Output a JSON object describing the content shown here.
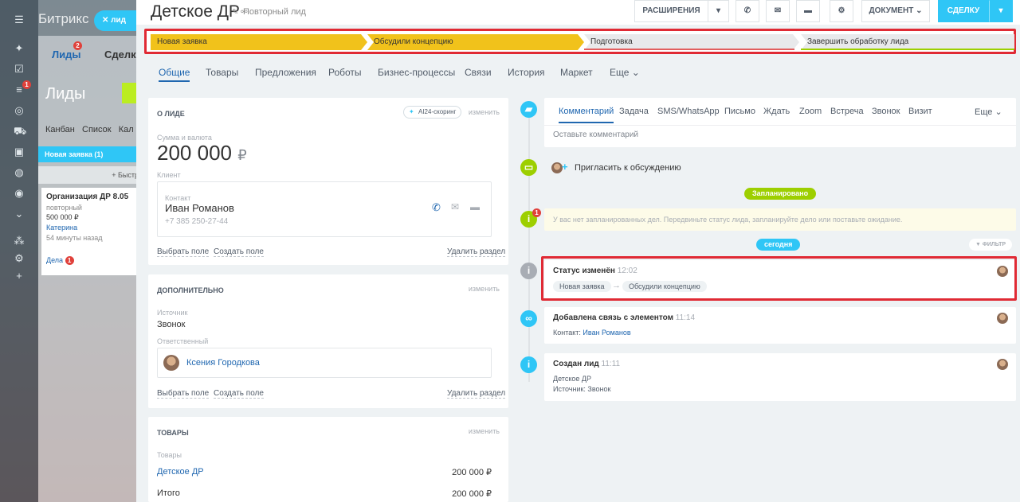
{
  "bg": {
    "portal_title": "Битрикс",
    "lid_button": "лид",
    "tab_leads": "Лиды",
    "tab_leads_badge": "2",
    "tab_deals": "Сделки",
    "nav_badge": "1",
    "page_title": "Лиды",
    "views": "Канбан   Список   Кал",
    "column": "Новая заявка (1)",
    "add_button": "+ Быстр",
    "card_title": "Организация ДР 8.05",
    "card_sub": "повторный",
    "card_price": "500 000 ₽",
    "card_person": "Катерина",
    "card_time": "54 минуты назад",
    "card_deals": "Дела",
    "card_deals_badge": "1"
  },
  "header": {
    "title": "Детское ДР",
    "subtitle": "Повторный лид",
    "btn_extensions": "РАСШИРЕНИЯ",
    "btn_document": "ДОКУМЕНТ",
    "btn_deal": "СДЕЛКУ"
  },
  "stages": [
    {
      "label": "Новая заявка",
      "color": "#f1c21b"
    },
    {
      "label": "Обсудили концепцию",
      "color": "#f1c21b"
    },
    {
      "label": "Подготовка",
      "color": "#e8e9eb"
    },
    {
      "label": "Завершить обработку лида",
      "color": "#e8e9eb"
    }
  ],
  "tabs": [
    "Общие",
    "Товары",
    "Предложения",
    "Роботы",
    "Бизнес-процессы",
    "Связи",
    "История",
    "Маркет",
    "Еще"
  ],
  "about": {
    "title": "О ЛИДЕ",
    "ai_scoring": "AI24-скоринг",
    "edit": "изменить",
    "sum_label": "Сумма и валюта",
    "sum_value": "200 000",
    "currency": "₽",
    "client_label": "Клиент",
    "contact_label": "Контакт",
    "contact_name": "Иван Романов",
    "contact_phone": "+7 385 250-27-44",
    "select_field": "Выбрать поле",
    "create_field": "Создать поле",
    "delete_section": "Удалить раздел"
  },
  "extra": {
    "title": "ДОПОЛНИТЕЛЬНО",
    "edit": "изменить",
    "source_label": "Источник",
    "source_value": "Звонок",
    "resp_label": "Ответственный",
    "resp_name": "Ксения Городкова",
    "select_field": "Выбрать поле",
    "create_field": "Создать поле",
    "delete_section": "Удалить раздел"
  },
  "products": {
    "title": "ТОВАРЫ",
    "edit": "изменить",
    "label": "Товары",
    "item_name": "Детское ДР",
    "item_price": "200 000 ₽",
    "total_label": "Итого",
    "total_value": "200 000 ₽"
  },
  "timeline": {
    "tabs": [
      "Комментарий",
      "Задача",
      "SMS/WhatsApp",
      "Письмо",
      "Ждать",
      "Zoom",
      "Встреча",
      "Звонок",
      "Визит"
    ],
    "more": "Еще",
    "comment_placeholder": "Оставьте комментарий",
    "invite": "Пригласить к обсуждению",
    "planned_pill": "Запланировано",
    "planned_badge": "1",
    "no_plans": "У вас нет запланированных дел. Передвиньте статус лида, запланируйте дело или поставьте ожидание.",
    "today_pill": "сегодня",
    "filter": "ФИЛЬТР",
    "events": [
      {
        "title": "Статус изменён",
        "time": "12:02",
        "from": "Новая заявка",
        "arrow": "→",
        "to": "Обсудили концепцию"
      },
      {
        "title": "Добавлена связь с элементом",
        "time": "11:14",
        "line_label": "Контакт:",
        "line_link": "Иван Романов"
      },
      {
        "title": "Создан лид",
        "time": "11:11",
        "line1": "Детское ДР",
        "line2": "Источник: Звонок"
      }
    ]
  },
  "colors": {
    "accent": "#2fc6f6",
    "link": "#2067b0",
    "stage_active": "#f1c21b",
    "highlight": "#e02a34",
    "green": "#9dcf00"
  }
}
